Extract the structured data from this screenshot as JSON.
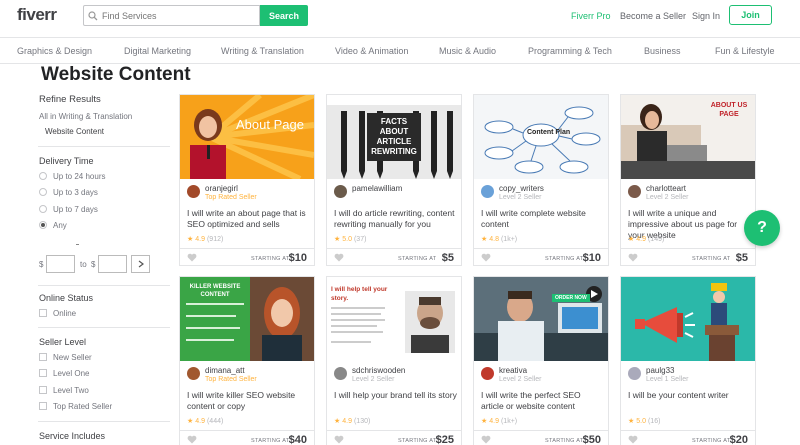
{
  "header": {
    "logo": "fiverr",
    "search_placeholder": "Find Services",
    "search_button": "Search",
    "links": [
      "Fiverr Pro",
      "Become a Seller",
      "Sign In"
    ],
    "join": "Join",
    "accent": "#1dbf73"
  },
  "categories": [
    "Graphics & Design",
    "Digital Marketing",
    "Writing & Translation",
    "Video & Animation",
    "Music & Audio",
    "Programming & Tech",
    "Business",
    "Fun & Lifestyle"
  ],
  "page_title": "Website Content",
  "sidebar": {
    "refine": "Refine Results",
    "parent_category": "All in Writing & Translation",
    "current_category": "Website Content",
    "delivery_title": "Delivery Time",
    "delivery_options": [
      "Up to 24 hours",
      "Up to 3 days",
      "Up to 7 days",
      "Any"
    ],
    "delivery_selected": "Any",
    "price_from": "$",
    "price_to": "to",
    "price_currency": "$",
    "online_title": "Online Status",
    "online_option": "Online",
    "level_title": "Seller Level",
    "level_options": [
      "New Seller",
      "Level One",
      "Level Two",
      "Top Rated Seller"
    ],
    "services_title": "Service Includes"
  },
  "gigs": [
    {
      "seller": "oranjegirl",
      "level": "Top Rated Seller",
      "title": "I will write an about page that is SEO optimized and sells",
      "rating": "4.9",
      "count": "(912)",
      "starting": "STARTING AT",
      "price": "$10",
      "thumb_text": "About Page"
    },
    {
      "seller": "pamelawilliam",
      "level": "",
      "title": "I will do article rewriting, content rewriting manually for you",
      "rating": "5.0",
      "count": "(37)",
      "starting": "STARTING AT",
      "price": "$5",
      "thumb_text": "FACTS ABOUT ARTICLE REWRITING"
    },
    {
      "seller": "copy_writers",
      "level": "Level 2 Seller",
      "title": "I will write complete website content",
      "rating": "4.8",
      "count": "(1k+)",
      "starting": "STARTING AT",
      "price": "$10",
      "thumb_text": "Content Plan"
    },
    {
      "seller": "charlotteart",
      "level": "Level 2 Seller",
      "title": "I will write a unique and impressive about us page for your website",
      "rating": "4.9",
      "count": "(149)",
      "starting": "STARTING AT",
      "price": "$5",
      "thumb_text": "ABOUT US PAGE"
    },
    {
      "seller": "dimana_att",
      "level": "Top Rated Seller",
      "title": "I will write killer SEO website content or copy",
      "rating": "4.9",
      "count": "(444)",
      "starting": "STARTING AT",
      "price": "$40",
      "thumb_text": "KILLER WEBSITE CONTENT"
    },
    {
      "seller": "sdchriswooden",
      "level": "Level 2 Seller",
      "title": "I will help your brand tell its story",
      "rating": "4.9",
      "count": "(130)",
      "starting": "STARTING AT",
      "price": "$25",
      "thumb_text": "I will help tell your story."
    },
    {
      "seller": "kreativa",
      "level": "Level 2 Seller",
      "title": "I will write the perfect SEO article or website content",
      "rating": "4.9",
      "count": "(1k+)",
      "starting": "STARTING AT",
      "price": "$50",
      "thumb_text": "ORDER NOW"
    },
    {
      "seller": "paulg33",
      "level": "Level 1 Seller",
      "title": "I will be your content writer",
      "rating": "5.0",
      "count": "(16)",
      "starting": "STARTING AT",
      "price": "$20",
      "thumb_text": ""
    }
  ],
  "help_button": "?"
}
